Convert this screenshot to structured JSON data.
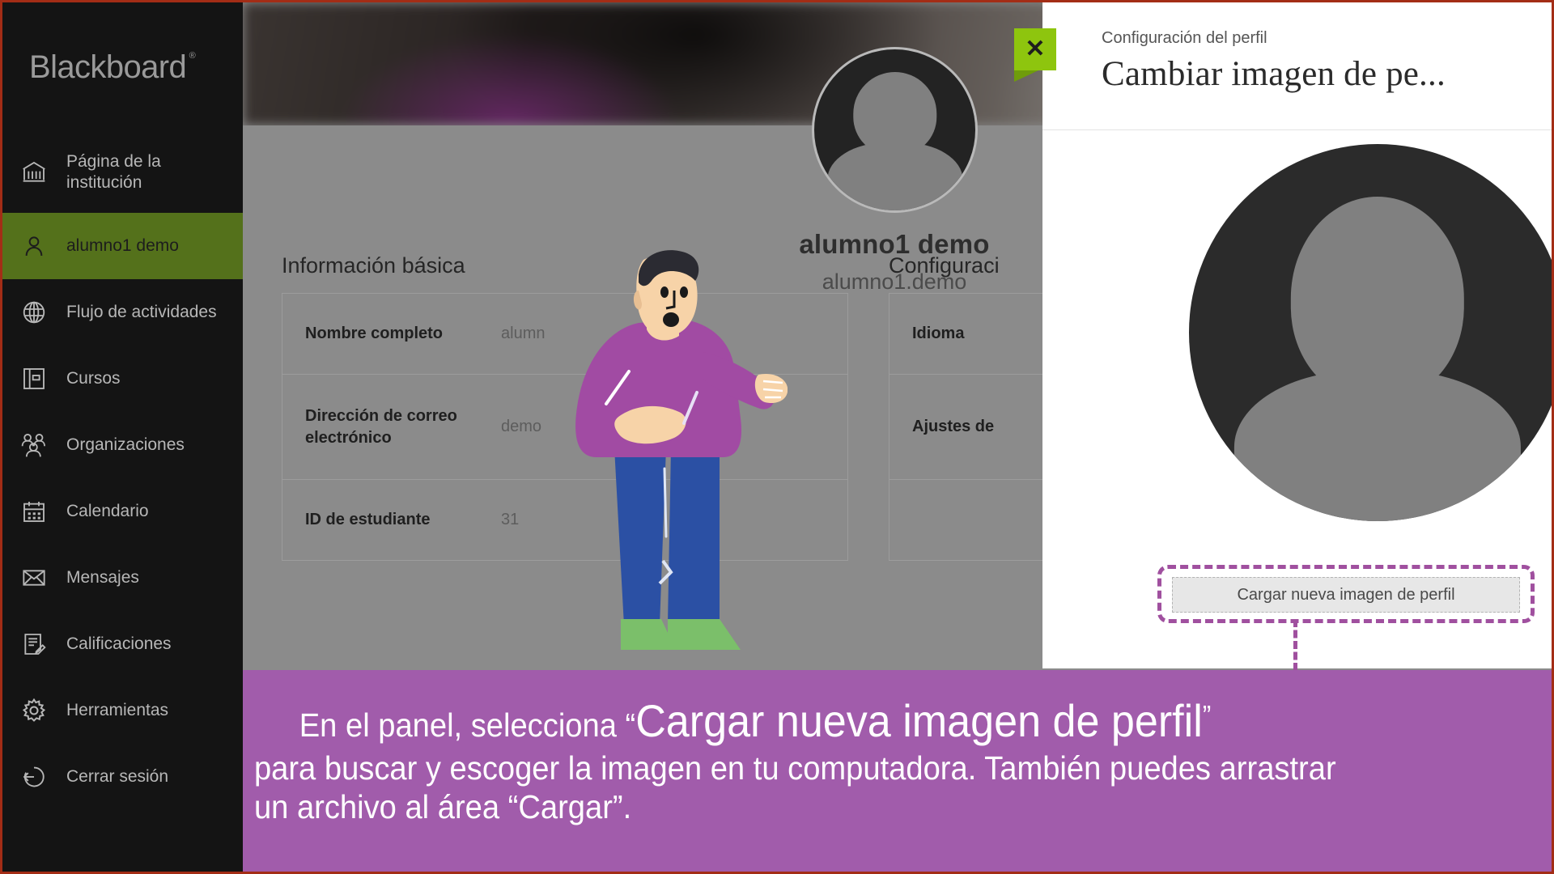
{
  "brand": {
    "name": "Blackboard",
    "logo_color": "#9a9a9a",
    "accent_olive": "#54711b",
    "accent_green": "#8ec50e"
  },
  "sidebar": {
    "items": [
      {
        "label": "Página de la institución",
        "icon": "institution-icon",
        "active": false
      },
      {
        "label": "alumno1 demo",
        "icon": "person-icon",
        "active": true
      },
      {
        "label": "Flujo de actividades",
        "icon": "globe-icon",
        "active": false
      },
      {
        "label": "Cursos",
        "icon": "book-icon",
        "active": false
      },
      {
        "label": "Organizaciones",
        "icon": "group-icon",
        "active": false
      },
      {
        "label": "Calendario",
        "icon": "calendar-icon",
        "active": false
      },
      {
        "label": "Mensajes",
        "icon": "envelope-icon",
        "active": false
      },
      {
        "label": "Calificaciones",
        "icon": "gradebook-icon",
        "active": false
      },
      {
        "label": "Herramientas",
        "icon": "gear-icon",
        "active": false
      },
      {
        "label": "Cerrar sesión",
        "icon": "logout-icon",
        "active": false
      }
    ]
  },
  "profile": {
    "display_name": "alumno1 demo",
    "username": "alumno1.demo",
    "avatar_icon": "avatar-placeholder-icon"
  },
  "basic_info": {
    "title": "Información básica",
    "rows": [
      {
        "key": "Nombre completo",
        "value": "alumn"
      },
      {
        "key": "Dirección de correo electrónico",
        "value": "demo"
      },
      {
        "key": "ID de estudiante",
        "value": "31"
      }
    ]
  },
  "config_info": {
    "title": "Configuraci",
    "rows": [
      {
        "key": "Idioma",
        "value": ""
      },
      {
        "key": "Ajustes de",
        "value": ""
      }
    ]
  },
  "panel": {
    "eyebrow": "Configuración del perfil",
    "title": "Cambiar imagen de pe...",
    "close_label": "✕",
    "close_icon": "close-icon",
    "avatar_icon": "avatar-placeholder-large-icon",
    "upload_button": "Cargar nueva imagen de perfil"
  },
  "caption": {
    "line1_pre": "En el panel, selecciona “",
    "line1_big": "Cargar nueva imagen de perfil",
    "line1_post": "”",
    "line2": "para buscar y escoger la imagen en tu computadora. También puedes arrastrar",
    "line3": "un archivo al área “Cargar”.",
    "bg_color": "#a15cab",
    "annotation_color": "#a0509f"
  }
}
